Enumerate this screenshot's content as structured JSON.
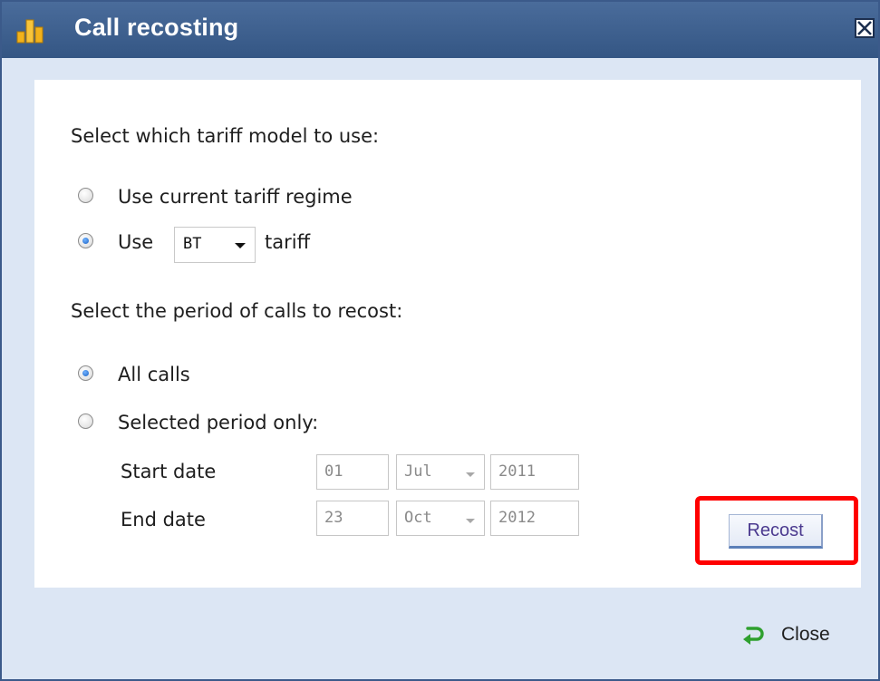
{
  "window": {
    "title": "Call recosting",
    "close_glyph": "X",
    "icon": "bar-chart-icon"
  },
  "tariff": {
    "heading": "Select which tariff model to use:",
    "option_current": "Use current tariff regime",
    "option_use_prefix": "Use",
    "option_use_suffix": "tariff",
    "selected_tariff": "BT",
    "selected_option": "use-tariff"
  },
  "period": {
    "heading": "Select the period of calls to recost:",
    "option_all": "All calls",
    "option_selected": "Selected period only:",
    "selected_option": "all-calls",
    "start_label": "Start date",
    "start_day": "01",
    "start_month": "Jul",
    "start_year": "2011",
    "end_label": "End date",
    "end_day": "23",
    "end_month": "Oct",
    "end_year": "2012"
  },
  "actions": {
    "recost_label": "Recost",
    "close_label": "Close"
  },
  "colors": {
    "titlebar": "#3c5f8f",
    "dialog_bg": "#dce6f4",
    "highlight": "#ff0000"
  }
}
